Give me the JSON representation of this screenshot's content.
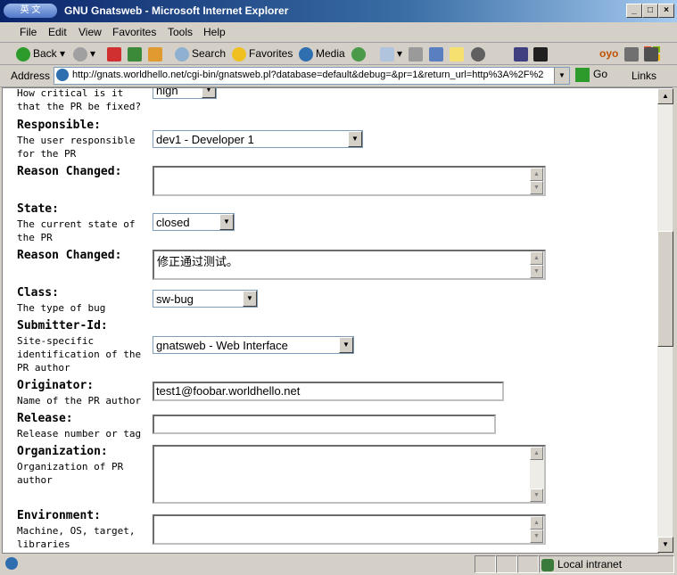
{
  "window": {
    "title": "GNU Gnatsweb - Microsoft Internet Explorer",
    "icon_text": "英 文"
  },
  "menu": [
    "File",
    "Edit",
    "View",
    "Favorites",
    "Tools",
    "Help"
  ],
  "toolbar": {
    "back": "Back",
    "search": "Search",
    "favorites": "Favorites",
    "media": "Media"
  },
  "address": {
    "label": "Address",
    "url": "http://gnats.worldhello.net/cgi-bin/gnatsweb.pl?database=default&debug=&pr=1&return_url=http%3A%2F%2",
    "go": "Go",
    "links": "Links"
  },
  "form": {
    "criticality_help": "How critical is it\nthat the PR be fixed?",
    "criticality_value": "high",
    "responsible": {
      "label": "Responsible:",
      "help": "The user responsible\nfor the PR",
      "value": "dev1 - Developer 1"
    },
    "reason1": {
      "label": "Reason Changed:",
      "value": ""
    },
    "state": {
      "label": "State:",
      "help": "The current state of\nthe PR",
      "value": "closed"
    },
    "reason2": {
      "label": "Reason Changed:",
      "value": "修正通过测试。"
    },
    "class": {
      "label": "Class:",
      "help": "The type of bug",
      "value": "sw-bug"
    },
    "submitter": {
      "label": "Submitter-Id:",
      "help": "Site-specific\nidentification of the\nPR author",
      "value": "gnatsweb - Web Interface"
    },
    "originator": {
      "label": "Originator:",
      "help": "Name of the PR author",
      "value": "test1@foobar.worldhello.net"
    },
    "release": {
      "label": "Release:",
      "help": "Release number or tag",
      "value": ""
    },
    "organization": {
      "label": "Organization:",
      "help": "Organization of PR\nauthor",
      "value": ""
    },
    "environment": {
      "label": "Environment:",
      "help": "Machine, OS, target,\nlibraries",
      "value": ""
    }
  },
  "status": {
    "zone": "Local intranet"
  },
  "colors": {
    "titlebar": "#0a246a",
    "chrome": "#d4d0c8"
  }
}
